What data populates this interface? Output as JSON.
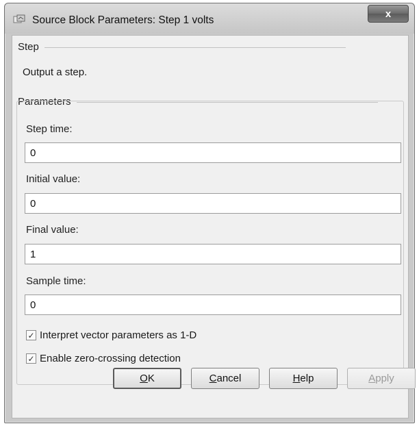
{
  "window": {
    "title": "Source Block Parameters: Step 1 volts",
    "close_label": "x"
  },
  "block": {
    "type_name": "Step",
    "description": "Output a step."
  },
  "parameters": {
    "heading": "Parameters",
    "step_time": {
      "label": "Step time:",
      "value": "0"
    },
    "initial_value": {
      "label": "Initial value:",
      "value": "0"
    },
    "final_value": {
      "label": "Final value:",
      "value": "1"
    },
    "sample_time": {
      "label": "Sample time:",
      "value": "0"
    },
    "interpret_vector": {
      "label": "Interpret vector parameters as 1-D",
      "checked": true
    },
    "zero_crossing": {
      "label": "Enable zero-crossing detection",
      "checked": true
    }
  },
  "buttons": {
    "ok": {
      "first": "O",
      "rest": "K"
    },
    "cancel": {
      "first": "C",
      "rest": "ancel"
    },
    "help": {
      "first": "H",
      "rest": "elp"
    },
    "apply": {
      "first": "A",
      "rest": "pply"
    }
  },
  "icons": {
    "app": "simulink-block-icon",
    "close": "close-icon",
    "check": "checkmark-icon"
  }
}
